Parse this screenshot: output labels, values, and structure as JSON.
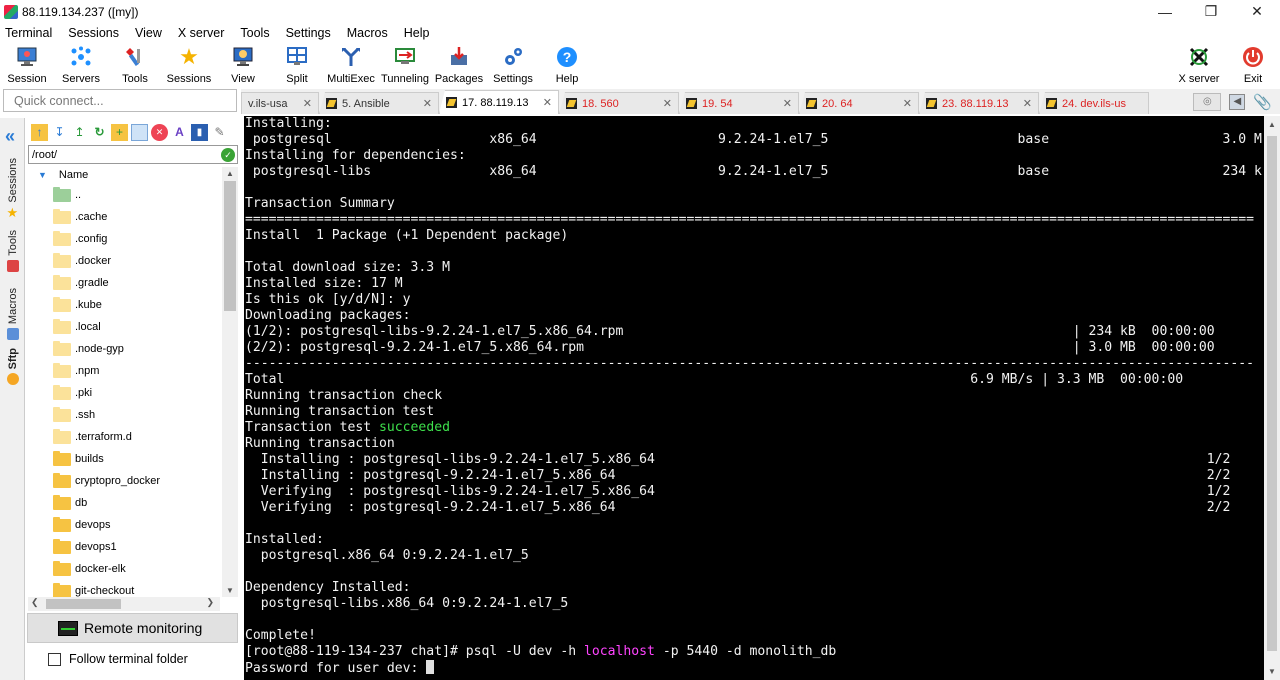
{
  "window": {
    "title": "88.119.134.237 ([my])"
  },
  "menu": [
    "Terminal",
    "Sessions",
    "View",
    "X server",
    "Tools",
    "Settings",
    "Macros",
    "Help"
  ],
  "toolbar": {
    "left": [
      {
        "label": "Session",
        "icon": "session-icon"
      },
      {
        "label": "Servers",
        "icon": "servers-icon"
      },
      {
        "label": "Tools",
        "icon": "tools-icon"
      },
      {
        "label": "Sessions",
        "icon": "star-icon"
      },
      {
        "label": "View",
        "icon": "view-icon"
      },
      {
        "label": "Split",
        "icon": "split-icon"
      },
      {
        "label": "MultiExec",
        "icon": "multiexec-icon"
      },
      {
        "label": "Tunneling",
        "icon": "tunneling-icon"
      },
      {
        "label": "Packages",
        "icon": "packages-icon"
      },
      {
        "label": "Settings",
        "icon": "settings-icon"
      },
      {
        "label": "Help",
        "icon": "help-icon"
      }
    ],
    "right": [
      {
        "label": "X server",
        "icon": "xserver-icon"
      },
      {
        "label": "Exit",
        "icon": "power-icon"
      }
    ]
  },
  "quick_connect": {
    "placeholder": "Quick connect..."
  },
  "tabs": [
    {
      "label": "v.ils-usa",
      "active": false,
      "red": false
    },
    {
      "label": "5. Ansible",
      "active": false,
      "red": false
    },
    {
      "label": "17. 88.119.13",
      "active": true,
      "red": false
    },
    {
      "label": "18. 560",
      "active": false,
      "red": true
    },
    {
      "label": "19. 54",
      "active": false,
      "red": true
    },
    {
      "label": "20. 64",
      "active": false,
      "red": true
    },
    {
      "label": "23. 88.119.13",
      "active": false,
      "red": true
    },
    {
      "label": "24. dev.ils-us",
      "active": false,
      "red": true
    }
  ],
  "vertical_tabs": [
    "Sessions",
    "Tools",
    "Macros",
    "Sftp"
  ],
  "sftp": {
    "path": "/root/",
    "column": "Name",
    "files": [
      {
        "name": "..",
        "kind": "up"
      },
      {
        "name": ".cache",
        "kind": "hidden"
      },
      {
        "name": ".config",
        "kind": "hidden"
      },
      {
        "name": ".docker",
        "kind": "hidden"
      },
      {
        "name": ".gradle",
        "kind": "hidden"
      },
      {
        "name": ".kube",
        "kind": "hidden"
      },
      {
        "name": ".local",
        "kind": "hidden"
      },
      {
        "name": ".node-gyp",
        "kind": "hidden"
      },
      {
        "name": ".npm",
        "kind": "hidden"
      },
      {
        "name": ".pki",
        "kind": "hidden"
      },
      {
        "name": ".ssh",
        "kind": "hidden"
      },
      {
        "name": ".terraform.d",
        "kind": "hidden"
      },
      {
        "name": "builds",
        "kind": "folder"
      },
      {
        "name": "cryptopro_docker",
        "kind": "folder"
      },
      {
        "name": "db",
        "kind": "folder"
      },
      {
        "name": "devops",
        "kind": "folder"
      },
      {
        "name": "devops1",
        "kind": "folder"
      },
      {
        "name": "docker-elk",
        "kind": "folder"
      },
      {
        "name": "git-checkout",
        "kind": "folder"
      }
    ],
    "remote_monitoring": "Remote monitoring",
    "follow_terminal": "Follow terminal folder"
  },
  "terminal": {
    "lines": [
      [
        {
          "t": "Installing:"
        }
      ],
      [
        {
          "t": " postgresql                    x86_64                       9.2.24-1.el7_5                        base                      3.0 M"
        }
      ],
      [
        {
          "t": "Installing for dependencies:"
        }
      ],
      [
        {
          "t": " postgresql-libs               x86_64                       9.2.24-1.el7_5                        base                      234 k"
        }
      ],
      [
        {
          "t": ""
        }
      ],
      [
        {
          "t": "Transaction Summary"
        }
      ],
      [
        {
          "t": "================================================================================================================================"
        }
      ],
      [
        {
          "t": "Install  1 Package (+1 Dependent package)"
        }
      ],
      [
        {
          "t": ""
        }
      ],
      [
        {
          "t": "Total download size: 3.3 M"
        }
      ],
      [
        {
          "t": "Installed size: 17 M"
        }
      ],
      [
        {
          "t": "Is this ok [y/d/N]: y"
        }
      ],
      [
        {
          "t": "Downloading packages:"
        }
      ],
      [
        {
          "t": "(1/2): postgresql-libs-9.2.24-1.el7_5.x86_64.rpm                                                         | 234 kB  00:00:00"
        }
      ],
      [
        {
          "t": "(2/2): postgresql-9.2.24-1.el7_5.x86_64.rpm                                                              | 3.0 MB  00:00:00"
        }
      ],
      [
        {
          "t": "--------------------------------------------------------------------------------------------------------------------------------"
        }
      ],
      [
        {
          "t": "Total                                                                                       6.9 MB/s | 3.3 MB  00:00:00"
        }
      ],
      [
        {
          "t": "Running transaction check"
        }
      ],
      [
        {
          "t": "Running transaction test"
        }
      ],
      [
        {
          "t": "Transaction test "
        },
        {
          "t": "succeeded",
          "c": "g"
        }
      ],
      [
        {
          "t": "Running transaction"
        }
      ],
      [
        {
          "t": "  Installing : postgresql-libs-9.2.24-1.el7_5.x86_64                                                                      1/2"
        }
      ],
      [
        {
          "t": "  Installing : postgresql-9.2.24-1.el7_5.x86_64                                                                           2/2"
        }
      ],
      [
        {
          "t": "  Verifying  : postgresql-libs-9.2.24-1.el7_5.x86_64                                                                      1/2"
        }
      ],
      [
        {
          "t": "  Verifying  : postgresql-9.2.24-1.el7_5.x86_64                                                                           2/2"
        }
      ],
      [
        {
          "t": ""
        }
      ],
      [
        {
          "t": "Installed:"
        }
      ],
      [
        {
          "t": "  postgresql.x86_64 0:9.2.24-1.el7_5"
        }
      ],
      [
        {
          "t": ""
        }
      ],
      [
        {
          "t": "Dependency Installed:"
        }
      ],
      [
        {
          "t": "  postgresql-libs.x86_64 0:9.2.24-1.el7_5"
        }
      ],
      [
        {
          "t": ""
        }
      ],
      [
        {
          "t": "Complete!"
        }
      ],
      [
        {
          "t": "[root@88-119-134-237 chat]# psql -U dev -h "
        },
        {
          "t": "localhost",
          "c": "m"
        },
        {
          "t": " -p 5440 -d monolith_db"
        }
      ],
      [
        {
          "t": "Password for user dev: "
        },
        {
          "t": "",
          "cursor": true
        }
      ]
    ]
  },
  "colors": {
    "terminal_bg": "#000000",
    "success": "#3ee04c",
    "host": "#ff44ff",
    "tab_red": "#dd2222"
  }
}
